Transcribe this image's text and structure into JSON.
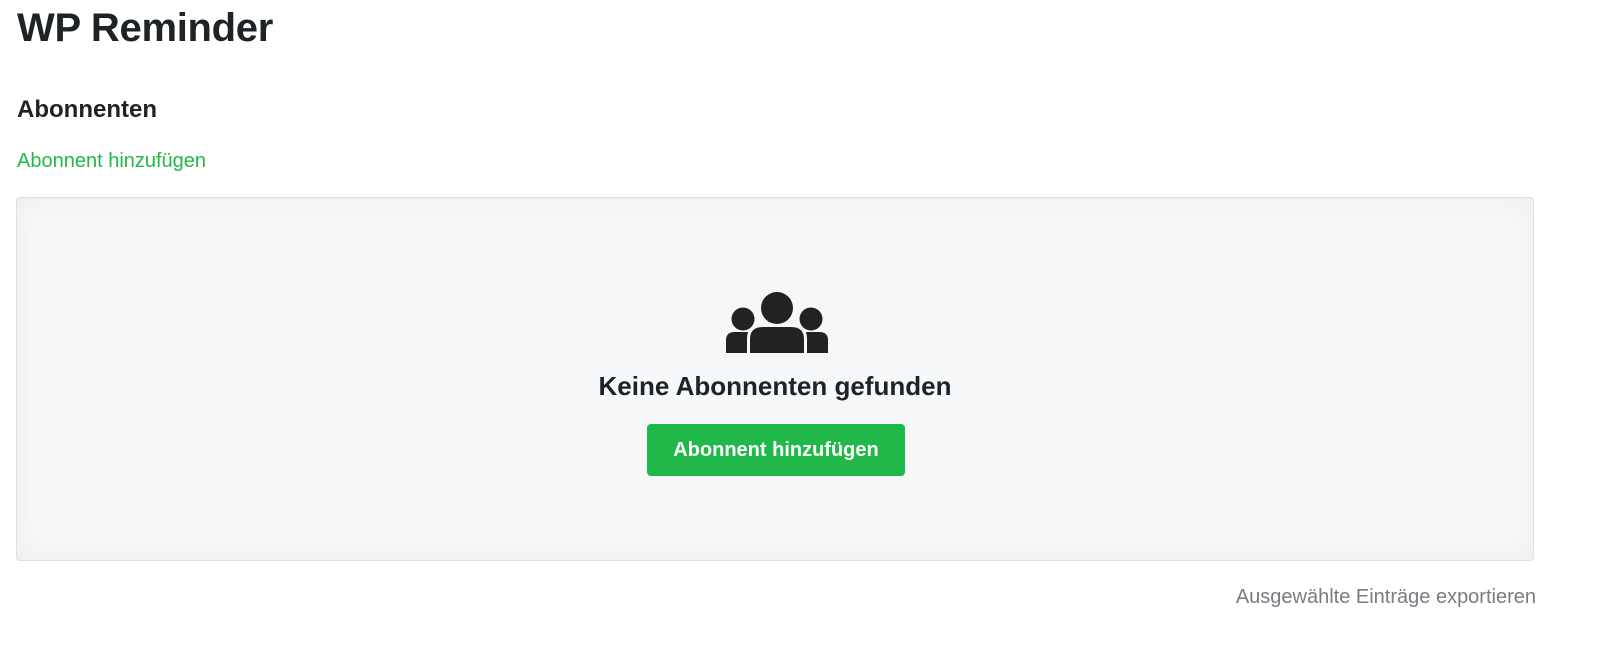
{
  "app": {
    "title": "WP Reminder"
  },
  "section": {
    "title": "Abonnenten",
    "add_link_label": "Abonnent hinzufügen"
  },
  "empty_state": {
    "icon": "users-icon",
    "message": "Keine Abonnenten gefunden",
    "button_label": "Abonnent hinzufügen"
  },
  "footer": {
    "export_label": "Ausgewählte Einträge exportieren"
  },
  "colors": {
    "accent": "#21b84a",
    "text": "#1d2327",
    "muted": "#787c82",
    "panel_bg": "#f6f7f9"
  }
}
